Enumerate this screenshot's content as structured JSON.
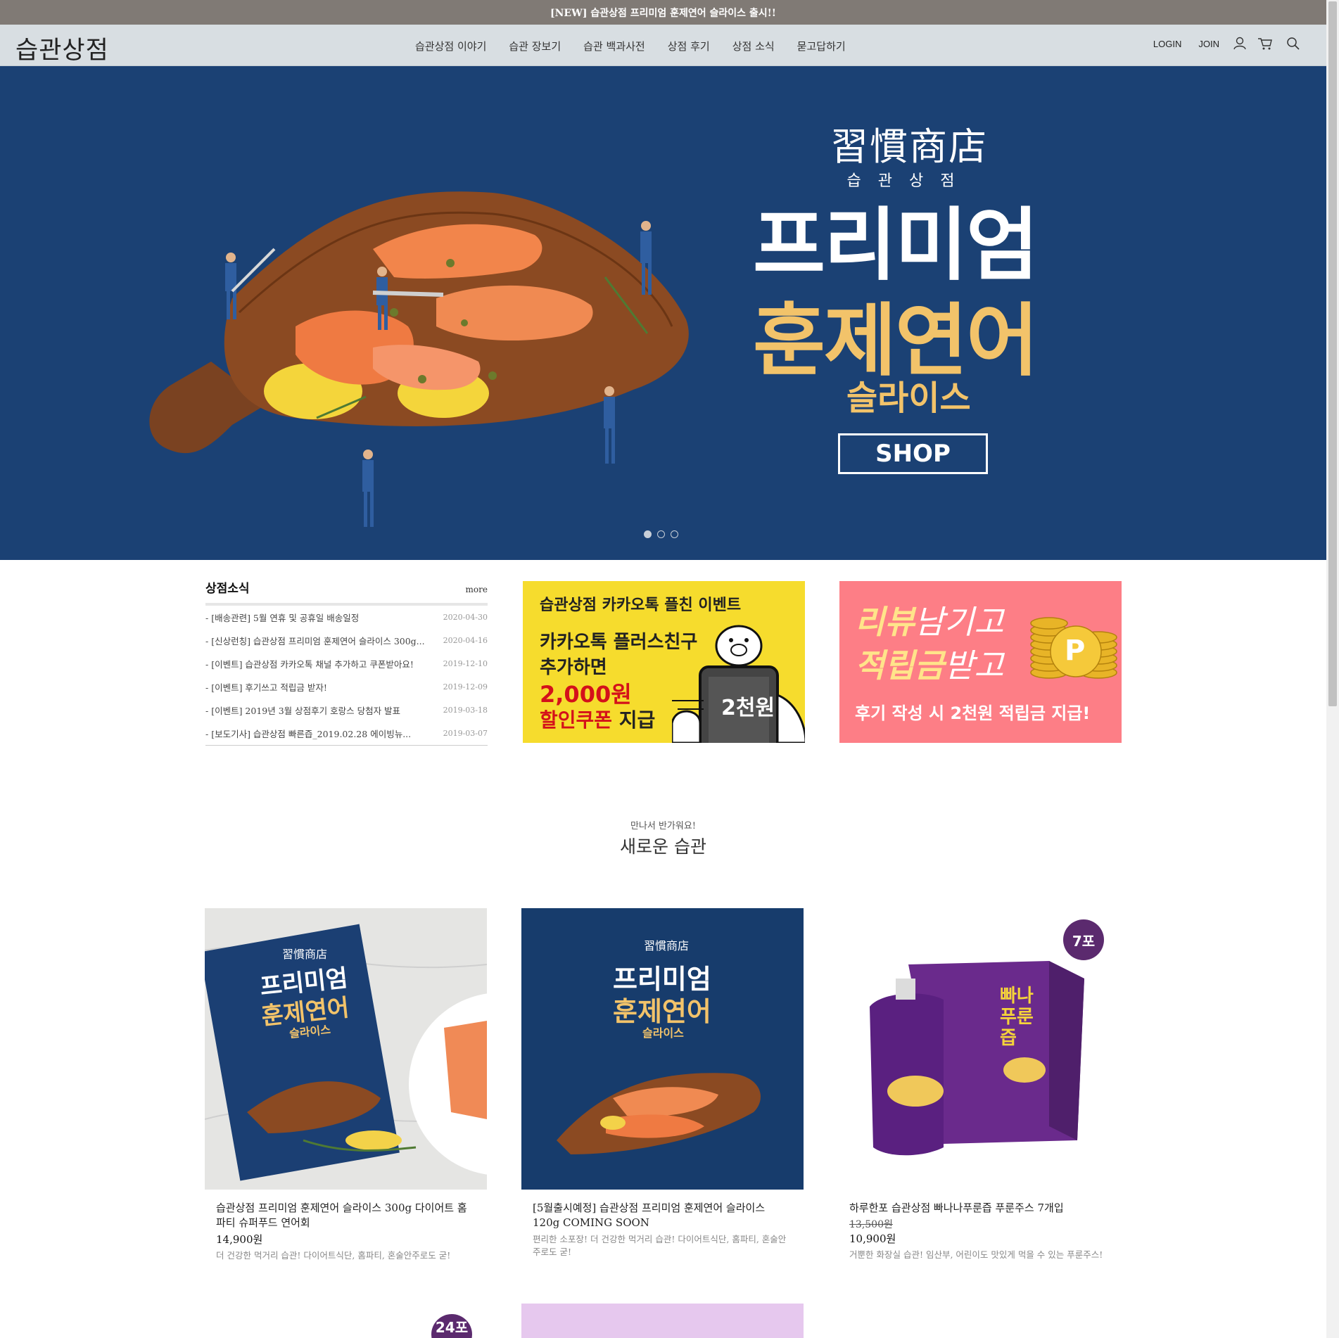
{
  "announce": {
    "text": "[NEW] 습관상점 프리미엄 훈제연어 슬라이스 출시!!"
  },
  "header": {
    "logo": "습관상점",
    "nav": [
      "습관상점 이야기",
      "습관 장보기",
      "습관 백과사전",
      "상점 후기",
      "상점 소식",
      "묻고답하기"
    ],
    "login": "LOGIN",
    "join": "JOIN"
  },
  "hero": {
    "brand_hanja": "習慣商店",
    "brand_kor": "습관상점",
    "title1": "프리미엄",
    "title2": "훈제연어",
    "title3": "슬라이스",
    "shop": "SHOP",
    "slides": 3,
    "active_slide": 1
  },
  "news": {
    "title": "상점소식",
    "more": "more",
    "items": [
      {
        "text": "- [배송관련] 5월 연휴 및 공휴일 배송일정",
        "date": "2020-04-30"
      },
      {
        "text": "- [신상런칭] 습관상점 프리미엄 훈제연어 슬라이스 300g...",
        "date": "2020-04-16"
      },
      {
        "text": "- [이벤트] 습관상점 카카오톡 채널 추가하고 쿠폰받아요!",
        "date": "2019-12-10"
      },
      {
        "text": "- [이벤트] 후기쓰고 적립금 받자!",
        "date": "2019-12-09"
      },
      {
        "text": "- [이벤트] 2019년 3월 상점후기 호랑스 당첨자 발표",
        "date": "2019-03-18"
      },
      {
        "text": "- [보도기사] 습관상점 빠른즙_2019.02.28 에이빙뉴...",
        "date": "2019-03-07"
      }
    ]
  },
  "banner_kakao": {
    "title": "습관상점 카카오톡 플친 이벤트",
    "line1": "카카오톡 플러스친구",
    "line2": "추가하면",
    "line3": "2,000원",
    "line4": "할인쿠폰",
    "line4b": "지급",
    "phone": "2천원"
  },
  "banner_review": {
    "line1a": "리뷰",
    "line1b": "남기고",
    "line2a": "적립금",
    "line2b": "받고",
    "line3": "후기 작성 시 2천원 적립금 지급!",
    "coin": "P"
  },
  "section": {
    "sub": "만나서 반가워요!",
    "title": "새로운 습관"
  },
  "products": [
    {
      "name": "습관상점 프리미엄 훈제연어 슬라이스 300g 다이어트 홈파티 슈퍼푸드 연어회",
      "price_old": "",
      "price": "14,900원",
      "desc": "더 건강한 먹거리 습관! 다이어트식단, 홈파티, 혼술안주로도 굳!",
      "pkg_brand": "習慣商店",
      "pkg_title1": "프리미엄",
      "pkg_title2": "훈제연어",
      "pkg_title3": "슬라이스"
    },
    {
      "name": "[5월출시예정] 습관상점 프리미엄 훈제연어 슬라이스 120g COMING SOON",
      "price_old": "",
      "price": "",
      "desc": "편리한 소포장! 더 건강한 먹거리 습관! 다이어트식단, 홈파티, 혼술안주로도 굳!",
      "pkg_brand": "習慣商店",
      "pkg_title1": "프리미엄",
      "pkg_title2": "훈제연어",
      "pkg_title3": "슬라이스"
    },
    {
      "name": "하루한포 습관상점 빠나나푸룬즙 푸룬주스 7개입",
      "price_old": "13,500원",
      "price": "10,900원",
      "desc": "거뿐한 화장실 습관! 임산부, 어린이도 맛있게 먹을 수 있는 푸룬주스!",
      "badge": "7포",
      "box_text": "빠나 푸룬즙"
    }
  ],
  "next_row": {
    "badge": "24포"
  },
  "colors": {
    "hero_bg": "#1b4174",
    "accent_gold": "#f2c36a",
    "kakao_yellow": "#f6dc2d",
    "review_pink": "#fd7e86",
    "announce_bg": "#807a75",
    "header_bg": "#d8dee2"
  }
}
